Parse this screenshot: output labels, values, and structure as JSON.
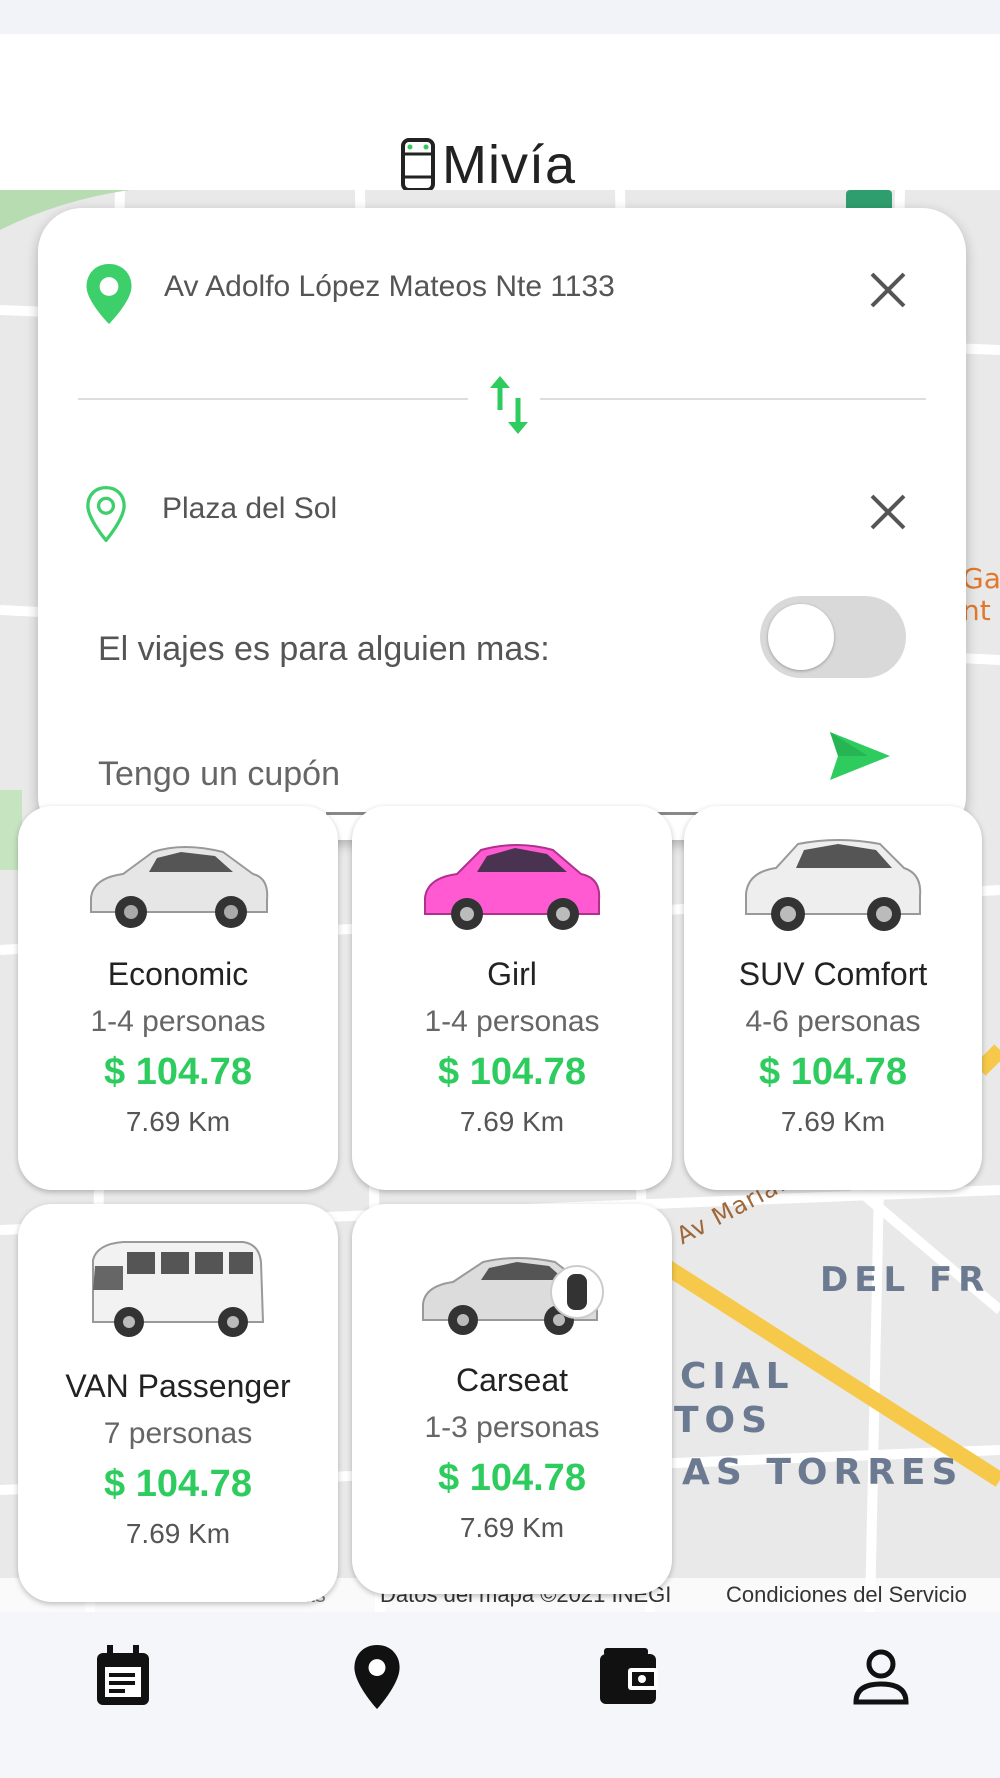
{
  "app": {
    "name": "Mivía"
  },
  "map": {
    "labels": [
      "DEL FR",
      "CIAL",
      "TOS",
      "AS TORRES",
      "Av Mariano",
      "Ga",
      "nt"
    ],
    "footer": [
      "Combinaciones de teclas",
      "Datos del mapa ©2021 INEGI",
      "Condiciones del Servicio"
    ]
  },
  "route": {
    "origin": "Av Adolfo López Mateos Nte 1133",
    "destination": "Plaza del Sol",
    "someone_else_label": "El viajes es para alguien mas:",
    "someone_else_enabled": false,
    "coupon_placeholder": "Tengo un cupón"
  },
  "vehicles": [
    {
      "name": "Economic",
      "capacity": "1-4 personas",
      "price": "$ 104.78",
      "distance": "7.69 Km",
      "color": "#e6e6e6"
    },
    {
      "name": "Girl",
      "capacity": "1-4 personas",
      "price": "$ 104.78",
      "distance": "7.69 Km",
      "color": "#ff5ad2"
    },
    {
      "name": "SUV Comfort",
      "capacity": "4-6 personas",
      "price": "$ 104.78",
      "distance": "7.69 Km",
      "color": "#eeeeee"
    },
    {
      "name": "VAN Passenger",
      "capacity": "7 personas",
      "price": "$ 104.78",
      "distance": "7.69 Km",
      "color": "#f2f2f2"
    },
    {
      "name": "Carseat",
      "capacity": "1-3 personas",
      "price": "$ 104.78",
      "distance": "7.69 Km",
      "color": "#dcdcdc"
    }
  ],
  "nav": [
    {
      "icon": "calendar-icon"
    },
    {
      "icon": "location-pin-icon"
    },
    {
      "icon": "wallet-icon"
    },
    {
      "icon": "profile-icon"
    }
  ],
  "colors": {
    "accent": "#2ecc5e",
    "map_bg": "#e8e8e8"
  }
}
